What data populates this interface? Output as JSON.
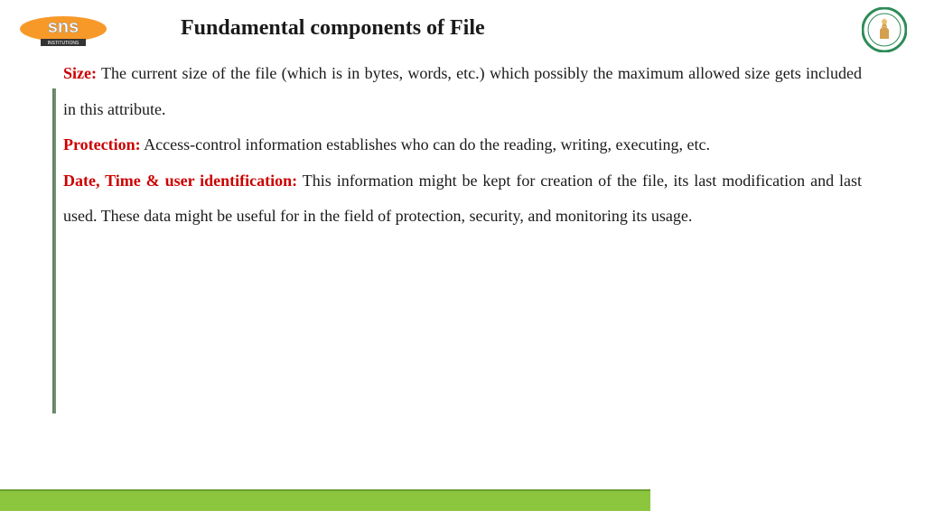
{
  "title": "Fundamental components of File",
  "terms": {
    "size": "Size:",
    "protection": "Protection:",
    "datetime": "Date, Time & user identification:"
  },
  "body": {
    "size": " The current size of the file (which is in bytes, words, etc.) which possibly the maximum allowed size gets included in this attribute.",
    "protection": " Access-control information establishes who can do the reading, writing, executing, etc.",
    "datetime": " This information might be kept for creation of the file, its last modification and last used. These data might be useful for in the field of protection, security, and monitoring its usage."
  },
  "logos": {
    "left_alt": "SNS Institutions",
    "right_alt": "College Seal"
  }
}
